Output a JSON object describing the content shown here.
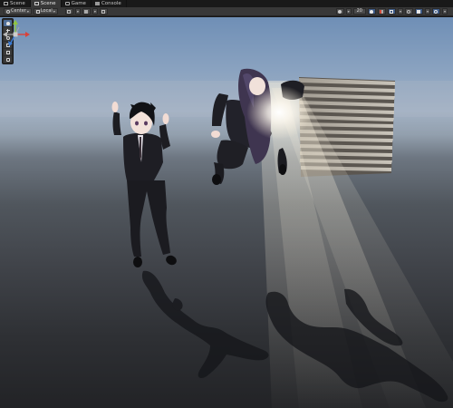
{
  "tabs": [
    {
      "label": "Scene",
      "active": false,
      "icon": "scene-icon"
    },
    {
      "label": "Scene",
      "active": true,
      "icon": "scene-icon"
    },
    {
      "label": "Game",
      "active": false,
      "icon": "game-icon"
    },
    {
      "label": "Console",
      "active": false,
      "icon": "console-icon"
    }
  ],
  "toolbar": {
    "pivot_label": "Center",
    "space_label": "Local",
    "gizmo_size_value": "20"
  },
  "tools": [
    "hand-tool",
    "move-tool",
    "rotate-tool",
    "scale-tool",
    "rect-tool",
    "transform-tool"
  ],
  "colors": {
    "accent": "#3d5a85",
    "sky_top": "#6f8fb6",
    "ground": "#2e3034",
    "gizmo_x": "#d9423a",
    "gizmo_y": "#8ec63f",
    "gizmo_z": "#3a7bd5"
  }
}
